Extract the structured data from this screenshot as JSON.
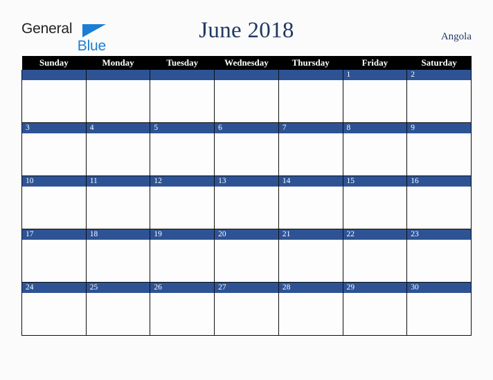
{
  "brand": {
    "name_part1": "General",
    "name_part2": "Blue",
    "triangle_icon": "triangle-icon",
    "color_dark": "#231f20",
    "color_blue": "#1a7fd4"
  },
  "header": {
    "title": "June 2018",
    "region": "Angola",
    "title_color": "#1f3864"
  },
  "calendar": {
    "month": "June",
    "year": "2018",
    "weekday_headers": [
      "Sunday",
      "Monday",
      "Tuesday",
      "Wednesday",
      "Thursday",
      "Friday",
      "Saturday"
    ],
    "header_bg": "#000000",
    "header_text_color": "#ffffff",
    "daynum_band_color": "#2e5395",
    "cell_bg": "#fdfdfd",
    "grid_line_color": "#0d0d0d",
    "weeks": [
      [
        "",
        "",
        "",
        "",
        "",
        "1",
        "2"
      ],
      [
        "3",
        "4",
        "5",
        "6",
        "7",
        "8",
        "9"
      ],
      [
        "10",
        "11",
        "12",
        "13",
        "14",
        "15",
        "16"
      ],
      [
        "17",
        "18",
        "19",
        "20",
        "21",
        "22",
        "23"
      ],
      [
        "24",
        "25",
        "26",
        "27",
        "28",
        "29",
        "30"
      ]
    ]
  }
}
